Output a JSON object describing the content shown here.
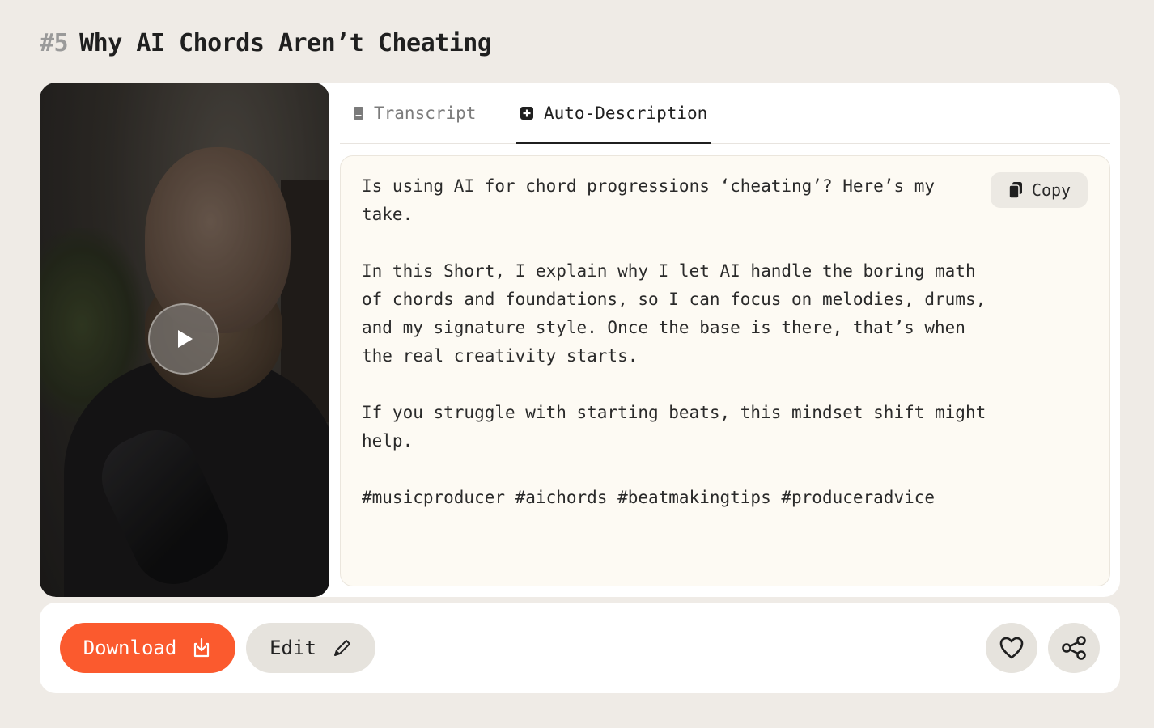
{
  "header": {
    "number": "#5",
    "title": "Why AI Chords Aren’t Cheating"
  },
  "video": {
    "play_icon": "play-icon"
  },
  "tabs": [
    {
      "label": "Transcript",
      "icon": "document-icon",
      "active": false
    },
    {
      "label": "Auto-Description",
      "icon": "sparkle-plus-icon",
      "active": true
    }
  ],
  "description": {
    "paragraphs": [
      "Is using AI for chord progressions ‘cheating’? Here’s my take.",
      "In this Short, I explain why I let AI handle the boring math of chords and foundations, so I can focus on melodies, drums, and my signature style. Once the base is there, that’s when the real creativity starts.",
      "If you struggle with starting beats, this mindset shift might help.",
      "#musicproducer #aichords #beatmakingtips #produceradvice"
    ],
    "copy_label": "Copy",
    "copy_icon": "copy-icon"
  },
  "actions": {
    "download_label": "Download",
    "download_icon": "download-icon",
    "edit_label": "Edit",
    "edit_icon": "pencil-icon",
    "like_icon": "heart-icon",
    "share_icon": "share-icon"
  },
  "colors": {
    "accent": "#fb5a2e",
    "background": "#efebe6",
    "panel": "#fdfaf3"
  }
}
